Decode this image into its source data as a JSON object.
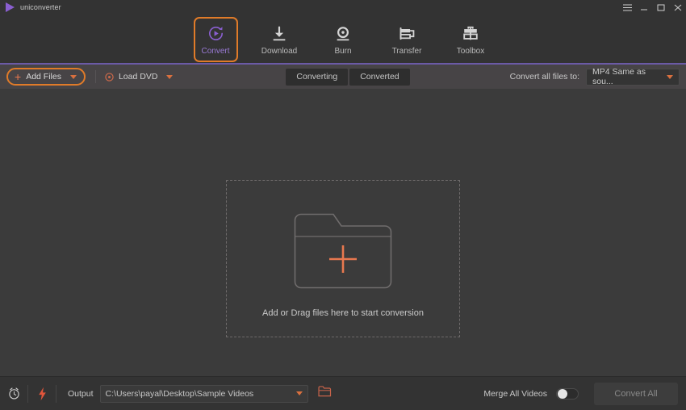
{
  "window": {
    "app_title": "uniconverter",
    "logo_icon": "play-triangle-logo",
    "controls": [
      {
        "name": "menu-button",
        "icon": "hamburger-menu-icon"
      },
      {
        "name": "minimize-button",
        "icon": "minimize-icon"
      },
      {
        "name": "maximize-button",
        "icon": "maximize-icon"
      },
      {
        "name": "close-button",
        "icon": "close-icon"
      }
    ]
  },
  "nav": {
    "items": [
      {
        "label": "Convert",
        "icon": "convert-circular-play-icon",
        "active": true
      },
      {
        "label": "Download",
        "icon": "download-arrow-icon",
        "active": false
      },
      {
        "label": "Burn",
        "icon": "burn-disc-icon",
        "active": false
      },
      {
        "label": "Transfer",
        "icon": "transfer-device-icon",
        "active": false
      },
      {
        "label": "Toolbox",
        "icon": "toolbox-icon",
        "active": false
      }
    ],
    "active_border_color": "#e07b29",
    "active_text_color": "#9a7ad6",
    "underline_color": "#6b5aa6"
  },
  "toolbar": {
    "add_files_label": "Add Files",
    "add_files_icon": "plus-icon",
    "add_files_caret_icon": "chevron-down-icon",
    "load_dvd_label": "Load DVD",
    "load_dvd_icon": "disc-icon",
    "load_dvd_caret_icon": "chevron-down-icon",
    "tabs": [
      {
        "label": "Converting"
      },
      {
        "label": "Converted"
      }
    ],
    "convert_all_to_label": "Convert all files to:",
    "format_value": "MP4 Same as sou...",
    "format_caret_icon": "chevron-down-icon"
  },
  "dropzone": {
    "folder_icon": "folder-icon",
    "plus_icon": "plus-icon",
    "message": "Add or Drag files here to start conversion"
  },
  "bottombar": {
    "timer_icon": "alarm-clock-icon",
    "speed_icon": "lightning-bolt-icon",
    "output_label": "Output",
    "output_path": "C:\\Users\\payal\\Desktop\\Sample Videos",
    "output_caret_icon": "chevron-down-icon",
    "browse_icon": "folder-open-icon",
    "merge_label": "Merge All Videos",
    "merge_enabled": false,
    "convert_all_label": "Convert All"
  },
  "colors": {
    "accent_orange": "#e07b29",
    "accent_purple": "#8a5fd0",
    "plus_salmon": "#e8784f",
    "bg_main": "#3b3b3b",
    "bg_chrome": "#333333",
    "bg_toolbar": "#474446"
  }
}
